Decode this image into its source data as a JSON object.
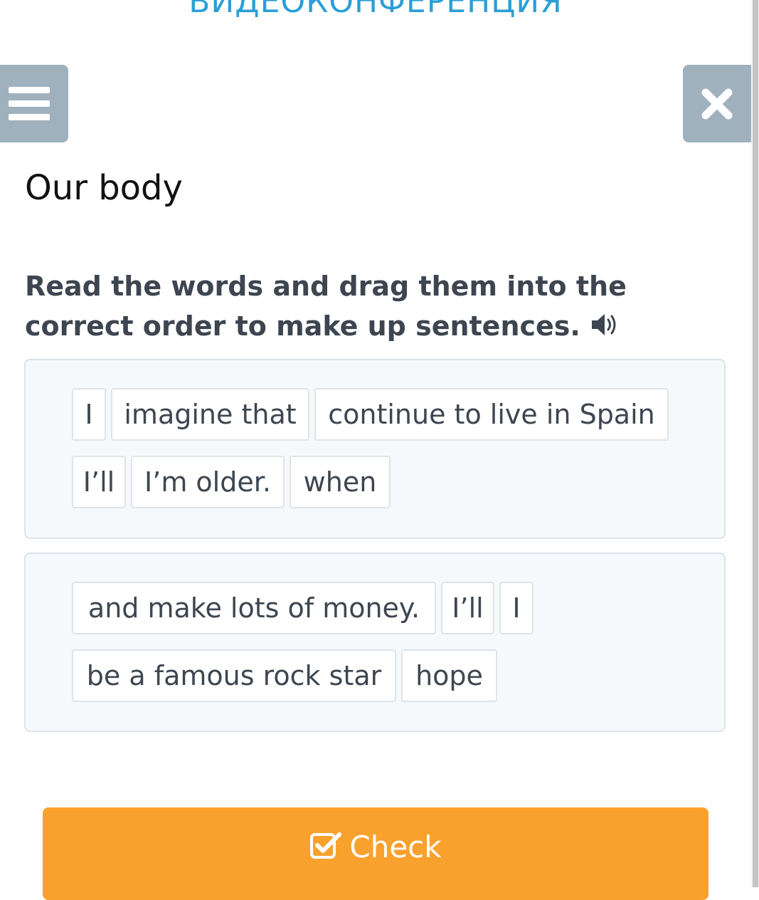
{
  "header": {
    "banner_text": "ВИДЕОКОНФЕРЕНЦИЯ"
  },
  "toolbar": {
    "menu_icon": "hamburger-menu-icon",
    "close_icon": "close-x-icon"
  },
  "lesson": {
    "title": "Our body",
    "instruction": "Read the words and drag them into the correct order to make up sentences.",
    "audio_icon": "speaker-icon"
  },
  "exercises": [
    {
      "words": [
        "I",
        "imagine that",
        "continue to live in Spain",
        "I’ll",
        "I’m older.",
        "when"
      ]
    },
    {
      "words": [
        "and make lots of money.",
        "I’ll",
        "I",
        "be a famous rock star",
        "hope"
      ]
    }
  ],
  "actions": {
    "check_label": "Check",
    "check_icon": "checkbox-icon"
  },
  "colors": {
    "banner": "#2b9ed8",
    "toolbar_button": "#9fb1bd",
    "check_button": "#f9a12d",
    "box_background": "#f5f9fc",
    "box_border": "#dde3e8"
  }
}
